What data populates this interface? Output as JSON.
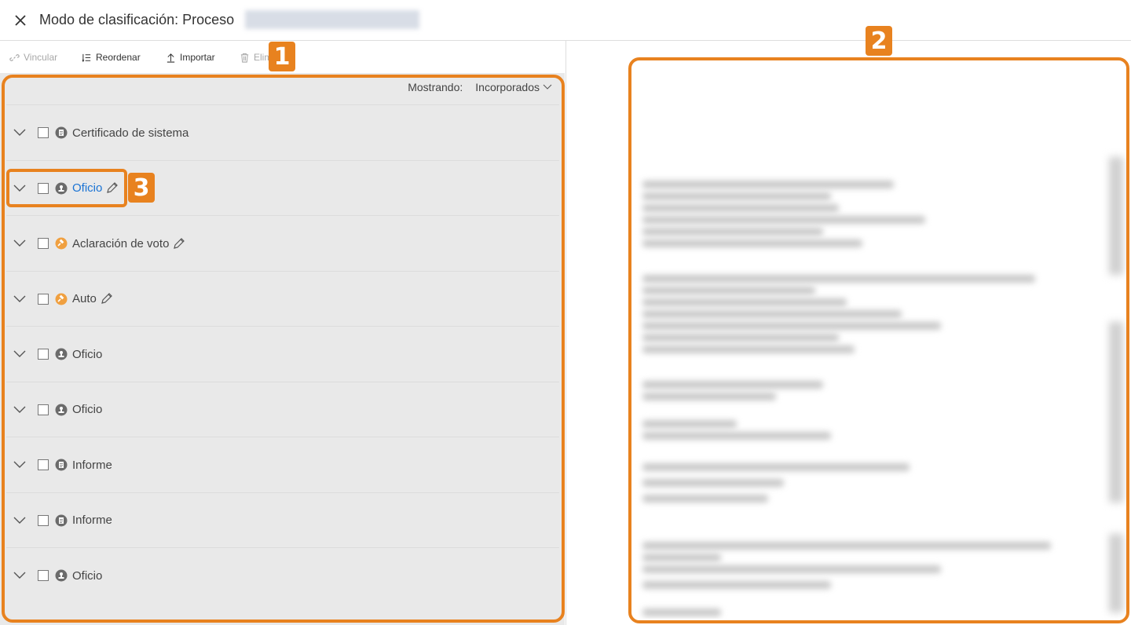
{
  "header": {
    "title": "Modo de clasificación: Proceso"
  },
  "toolbar": {
    "vincular": "Vincular",
    "reordenar": "Reordenar",
    "importar": "Importar",
    "eliminar": "Elim"
  },
  "list": {
    "showing_label": "Mostrando:",
    "showing_value": "Incorporados",
    "rows": [
      {
        "label": "Certificado de sistema",
        "icon": "doc-icon",
        "editable": false,
        "link": false
      },
      {
        "label": "Oficio",
        "icon": "stamp-icon",
        "editable": true,
        "link": true
      },
      {
        "label": "Aclaración de voto",
        "icon": "gavel-icon",
        "editable": true,
        "link": false
      },
      {
        "label": "Auto",
        "icon": "gavel-icon",
        "editable": true,
        "link": false
      },
      {
        "label": "Oficio",
        "icon": "stamp-icon",
        "editable": false,
        "link": false
      },
      {
        "label": "Oficio",
        "icon": "stamp-icon",
        "editable": false,
        "link": false
      },
      {
        "label": "Informe",
        "icon": "doc-icon",
        "editable": false,
        "link": false
      },
      {
        "label": "Informe",
        "icon": "doc-icon",
        "editable": false,
        "link": false
      },
      {
        "label": "Oficio",
        "icon": "stamp-icon",
        "editable": false,
        "link": false
      }
    ]
  },
  "annotations": {
    "one": "1",
    "two": "2",
    "three": "3"
  },
  "colors": {
    "accent": "#e8821f",
    "link": "#1a73d4",
    "gavel": "#f0a040",
    "icon": "#666666"
  }
}
